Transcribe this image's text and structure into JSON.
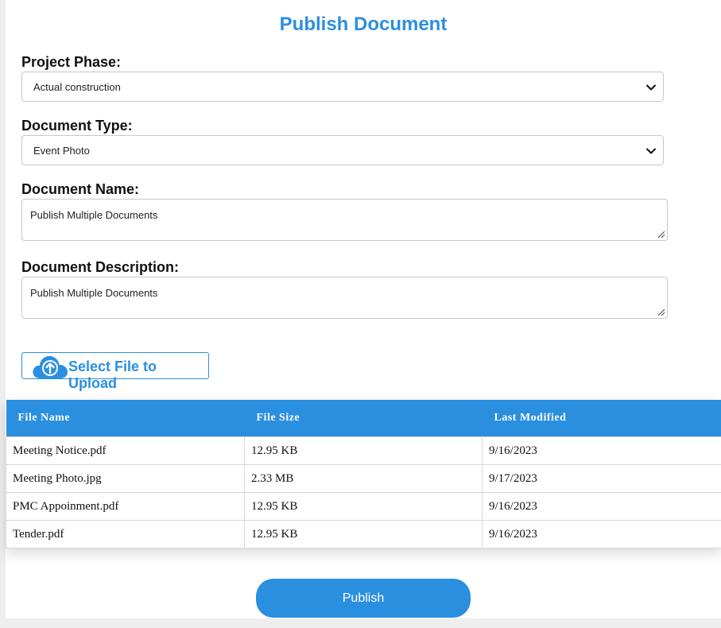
{
  "title": "Publish Document",
  "form": {
    "project_phase": {
      "label": "Project Phase:",
      "value": "Actual construction"
    },
    "document_type": {
      "label": "Document Type:",
      "value": "Event Photo"
    },
    "document_name": {
      "label": "Document Name:",
      "value": "Publish Multiple Documents"
    },
    "document_description": {
      "label": "Document Description:",
      "value": "Publish Multiple Documents"
    },
    "upload": {
      "label": "Select File to Upload",
      "icon": "cloud-upload-icon"
    }
  },
  "table": {
    "headers": [
      "File Name",
      "File Size",
      "Last Modified"
    ],
    "rows": [
      [
        "Meeting Notice.pdf",
        "12.95 KB",
        "9/16/2023"
      ],
      [
        "Meeting Photo.jpg",
        "2.33 MB",
        "9/17/2023"
      ],
      [
        "PMC Appoinment.pdf",
        "12.95 KB",
        "9/16/2023"
      ],
      [
        "Tender.pdf",
        "12.95 KB",
        "9/16/2023"
      ]
    ]
  },
  "publish_label": "Publish",
  "colors": {
    "accent": "#2b8fe0"
  }
}
